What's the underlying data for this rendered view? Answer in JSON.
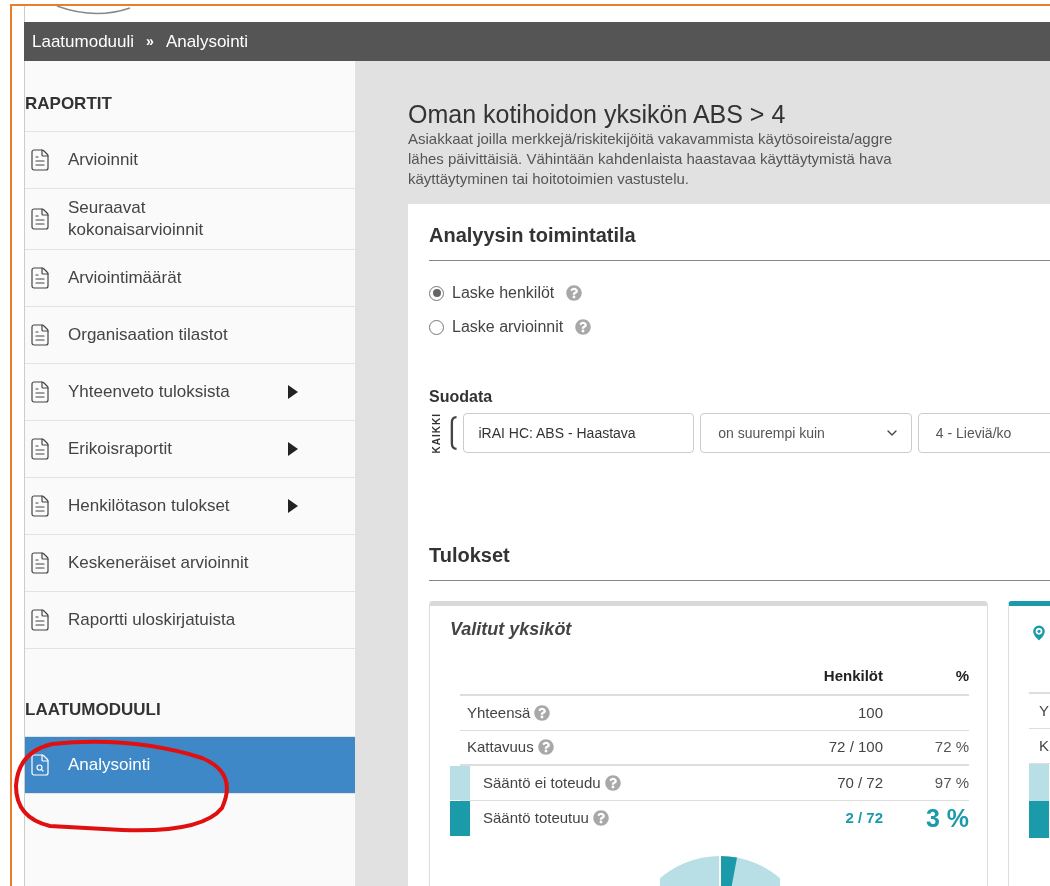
{
  "breadcrumb": {
    "items": [
      "Laatumoduuli",
      "Analysointi"
    ],
    "separator": "»"
  },
  "sidebar": {
    "sections": [
      {
        "heading": "RAPORTIT",
        "items": [
          {
            "label": "Arvioinnit",
            "kind": "report",
            "has_submenu": false,
            "selected": false
          },
          {
            "label": "Seuraavat kokonaisarvioinnit",
            "kind": "report",
            "has_submenu": false,
            "selected": false
          },
          {
            "label": "Arviointimäärät",
            "kind": "report",
            "has_submenu": false,
            "selected": false
          },
          {
            "label": "Organisaation tilastot",
            "kind": "report",
            "has_submenu": false,
            "selected": false
          },
          {
            "label": "Yhteenveto tuloksista",
            "kind": "report",
            "has_submenu": true,
            "selected": false
          },
          {
            "label": "Erikoisraportit",
            "kind": "report",
            "has_submenu": true,
            "selected": false
          },
          {
            "label": "Henkilötason tulokset",
            "kind": "report",
            "has_submenu": true,
            "selected": false
          },
          {
            "label": "Keskeneräiset arvioinnit",
            "kind": "report",
            "has_submenu": false,
            "selected": false
          },
          {
            "label": "Raportti uloskirjatuista",
            "kind": "report",
            "has_submenu": false,
            "selected": false
          }
        ]
      },
      {
        "heading": "LAATUMODUULI",
        "items": [
          {
            "label": "Analysointi",
            "kind": "analysis",
            "has_submenu": false,
            "selected": true
          }
        ]
      }
    ]
  },
  "page": {
    "title": "Oman kotihoidon yksikön ABS > 4",
    "description_lines": [
      "Asiakkaat joilla merkkejä/riskitekijöitä vakavammista käytösoireista/aggre",
      "lähes päivittäisiä. Vähintään kahdenlaista haastavaa käyttäytymistä hava",
      "käyttäytyminen tai hoitotoimien vastustelu."
    ]
  },
  "mode_panel": {
    "title": "Analyysin toimintatila",
    "options": [
      {
        "label": "Laske henkilöt",
        "selected": true
      },
      {
        "label": "Laske arvioinnit",
        "selected": false
      }
    ]
  },
  "filter": {
    "title": "Suodata",
    "group_label": "KAIKKI",
    "field": "iRAI HC: ABS - Haastava",
    "operator": "on suurempi kuin",
    "value": "4 - Lieviä/ko"
  },
  "results": {
    "title": "Tulokset",
    "selected_units": {
      "title": "Valitut yksiköt",
      "columns": [
        "Henkilöt",
        "%"
      ],
      "rows": [
        {
          "label": "Yhteensä",
          "count": "100",
          "emphasized": false
        },
        {
          "label": "Kattavuus",
          "count": "72 / 100",
          "percent": "72 %",
          "emphasized": false
        },
        {
          "label": "Sääntö ei toteudu",
          "count": "70 / 72",
          "percent": "97 %",
          "color": "#b7dfe5",
          "emphasized": false
        },
        {
          "label": "Sääntö toteutuu",
          "count": "2 / 72",
          "percent": "3 %",
          "color": "#1b9aaa",
          "emphasized": true
        }
      ]
    },
    "second_card": {
      "row_labels": [
        "Y",
        "K"
      ]
    }
  }
}
